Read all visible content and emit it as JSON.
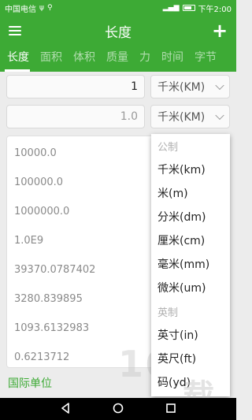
{
  "status_bar": {
    "carrier": "中国电信",
    "time": "下午2:00"
  },
  "app_bar": {
    "title": "长度"
  },
  "tabs": [
    {
      "label": "长度",
      "active": true
    },
    {
      "label": "面积",
      "active": false
    },
    {
      "label": "体积",
      "active": false
    },
    {
      "label": "质量",
      "active": false
    },
    {
      "label": "力",
      "active": false
    },
    {
      "label": "时间",
      "active": false
    },
    {
      "label": "字节",
      "active": false
    }
  ],
  "input": {
    "value": "1",
    "unit": "千米(KM)"
  },
  "output": {
    "value": "1.0",
    "unit": "千米(KM)"
  },
  "results": [
    "10000.0",
    "100000.0",
    "1000000.0",
    "1.0E9",
    "39370.0787402",
    "3280.839895",
    "1093.6132983",
    "0.6213712"
  ],
  "international_unit_label": "国际单位",
  "dropdown": {
    "items": [
      {
        "label": "公制",
        "header": true
      },
      {
        "label": "千米(km)",
        "header": false
      },
      {
        "label": "米(m)",
        "header": false
      },
      {
        "label": "分米(dm)",
        "header": false
      },
      {
        "label": "厘米(cm)",
        "header": false
      },
      {
        "label": "毫米(mm)",
        "header": false
      },
      {
        "label": "微米(um)",
        "header": false
      },
      {
        "label": "英制",
        "header": true
      },
      {
        "label": "英寸(in)",
        "header": false
      },
      {
        "label": "英尺(ft)",
        "header": false
      },
      {
        "label": "码(yd)",
        "header": false
      }
    ]
  },
  "watermark": {
    "text": "168",
    "sub": "载"
  },
  "colors": {
    "accent": "#3daa35"
  }
}
